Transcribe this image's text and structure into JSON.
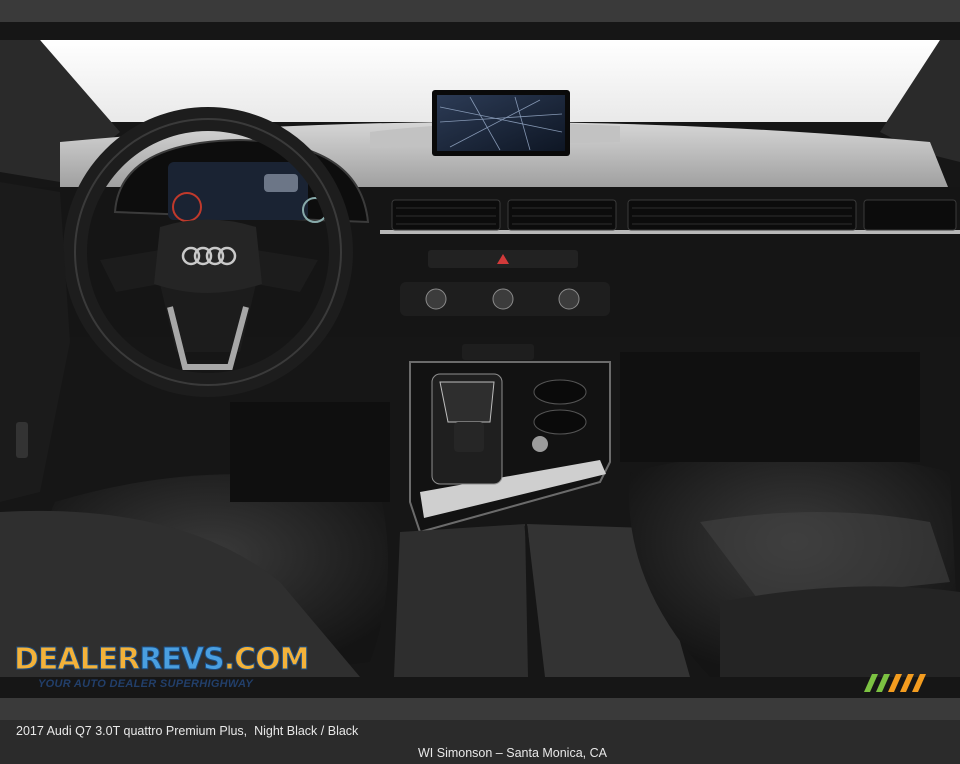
{
  "caption": {
    "vehicle": "2017 Audi Q7 3.0T quattro Premium Plus,  Night Black / Black",
    "dealer": "WI Simonson – Santa Monica, CA"
  },
  "photo": {
    "subject": "car-interior-dashboard-photo"
  },
  "watermark": {
    "brand_part1": "DEALER",
    "brand_part2": "REVS",
    "brand_part3": ".COM",
    "tagline": "YOUR AUTO DEALER SUPERHIGHWAY"
  },
  "colors": {
    "bar_bg": "#3a3a3a",
    "bar_text": "#e8e8e8",
    "brand_orange": "#f3b23a",
    "brand_blue": "#4a9fe0",
    "stripe_green": "#7cc242",
    "stripe_orange": "#f39c1f"
  }
}
